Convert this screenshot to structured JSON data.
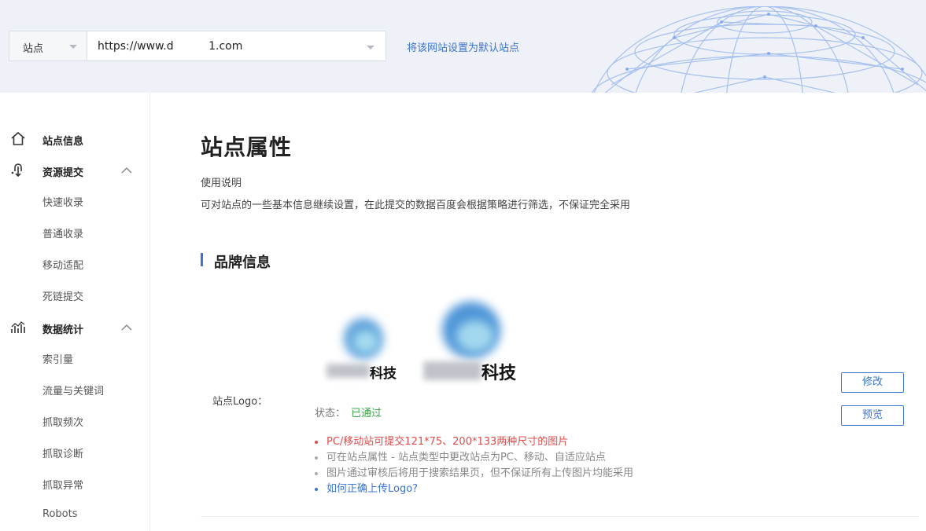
{
  "header": {
    "site_select": {
      "label": "站点"
    },
    "url": {
      "value": "https://www.d          1.com"
    },
    "set_default_link": "将该网站设置为默认站点"
  },
  "sidebar": {
    "groups": [
      {
        "label": "站点信息",
        "icon": "home-icon",
        "expanded": false,
        "items": []
      },
      {
        "label": "资源提交",
        "icon": "upload-link-icon",
        "expanded": true,
        "items": [
          "快速收录",
          "普通收录",
          "移动适配",
          "死链提交"
        ]
      },
      {
        "label": "数据统计",
        "icon": "stats-icon",
        "expanded": true,
        "items": [
          "索引量",
          "流量与关键词",
          "抓取频次",
          "抓取诊断",
          "抓取异常",
          "Robots"
        ]
      }
    ]
  },
  "main": {
    "title": "站点属性",
    "usage_title": "使用说明",
    "usage_desc": "可对站点的一些基本信息继续设置，在此提交的数据百度会根据策略进行筛选，不保证完全采用",
    "section_title": "品牌信息",
    "logo": {
      "label": "站点Logo：",
      "brand_suffix": "科技",
      "status_label": "状态：",
      "status_value": "已通过",
      "tips": [
        "PC/移动站可提交121*75、200*133两种尺寸的图片",
        "可在站点属性 - 站点类型中更改站点为PC、移动、自适应站点",
        "图片通过审核后将用于搜索结果页，但不保证所有上传图片均能采用",
        "如何正确上传Logo?"
      ],
      "edit_button": "修改",
      "preview_button": "预览"
    }
  },
  "colors": {
    "accent": "#3b74d1",
    "success": "#3aa845",
    "warning": "#e04b4b",
    "header_bg": "#eef1f7"
  }
}
